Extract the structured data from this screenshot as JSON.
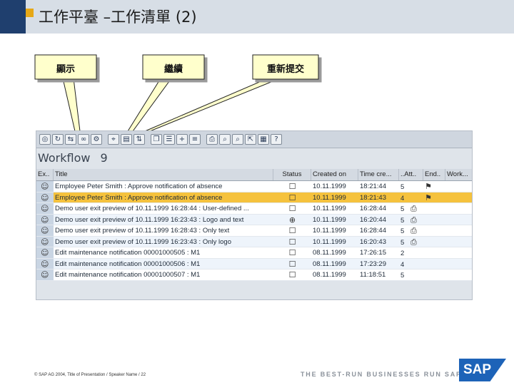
{
  "header": {
    "title": "工作平臺 –工作清單 (2)",
    "accent_dark": "#1f3f6e",
    "accent_gold": "#e6a817"
  },
  "callouts": [
    {
      "label": "顯示"
    },
    {
      "label": "繼續"
    },
    {
      "label": "重新提交"
    }
  ],
  "window": {
    "title": "Workflow",
    "count": "9",
    "toolbar_icons": [
      "workflow-icon",
      "refresh-icon",
      "forward-icon",
      "link-icon",
      "settings-icon",
      "execute-icon",
      "filter-icon",
      "sort-icon",
      "copy-icon",
      "details-icon",
      "new-icon",
      "list-icon",
      "print-icon",
      "find-icon",
      "find-next-icon",
      "export-icon",
      "layout-icon",
      "help-icon"
    ],
    "columns": [
      "Ex..",
      "Title",
      "Status",
      "Created on",
      "Time cre...",
      "..",
      "Att..",
      "End..",
      "Work..."
    ],
    "rows": [
      {
        "title": "Employee Peter Smith : Approve notification of absence",
        "status_icon": "☐",
        "created": "10.11.1999",
        "time": "18:21:44",
        "att": "5",
        "att_icon": "",
        "end_icon": "⚑",
        "selected": false
      },
      {
        "title": "Employee Peter Smith : Approve notification of absence",
        "status_icon": "☐",
        "created": "10.11.1999",
        "time": "18:21:43",
        "att": "4",
        "att_icon": "",
        "end_icon": "⚑",
        "selected": true
      },
      {
        "title": "Demo user exit preview of 10.11.1999 16:28:44 : User-defined ...",
        "status_icon": "☐",
        "created": "10.11.1999",
        "time": "16:28:44",
        "att": "5",
        "att_icon": "⎙",
        "end_icon": "",
        "selected": false
      },
      {
        "title": "Demo user exit preview of 10.11.1999 16:23:43 : Logo and text",
        "status_icon": "⊕",
        "created": "10.11.1999",
        "time": "16:20:44",
        "att": "5",
        "att_icon": "⎙",
        "end_icon": "",
        "selected": false
      },
      {
        "title": "Demo user exit preview of 10.11.1999 16:28:43 : Only text",
        "status_icon": "☐",
        "created": "10.11.1999",
        "time": "16:28:44",
        "att": "5",
        "att_icon": "⎙",
        "end_icon": "",
        "selected": false
      },
      {
        "title": "Demo user exit preview of 10.11.1999 16:23:43 : Only logo",
        "status_icon": "☐",
        "created": "10.11.1999",
        "time": "16:20:43",
        "att": "5",
        "att_icon": "⎙",
        "end_icon": "",
        "selected": false
      },
      {
        "title": "Edit maintenance notification 00001000505 : M1",
        "status_icon": "☐",
        "created": "08.11.1999",
        "time": "17:26:15",
        "att": "2",
        "att_icon": "",
        "end_icon": "",
        "selected": false
      },
      {
        "title": "Edit maintenance notification 00001000506 : M1",
        "status_icon": "☐",
        "created": "08.11.1999",
        "time": "17:23:29",
        "att": "4",
        "att_icon": "",
        "end_icon": "",
        "selected": false
      },
      {
        "title": "Edit maintenance notification 00001000507 : M1",
        "status_icon": "☐",
        "created": "08.11.1999",
        "time": "11:18:51",
        "att": "5",
        "att_icon": "",
        "end_icon": "",
        "selected": false
      }
    ]
  },
  "footer": {
    "copyright": "© SAP AG 2004, Title of Presentation / Speaker Name / 22",
    "tagline": "THE BEST-RUN BUSINESSES RUN SAP",
    "logo_text": "SAP",
    "logo_color": "#1d63b8"
  }
}
